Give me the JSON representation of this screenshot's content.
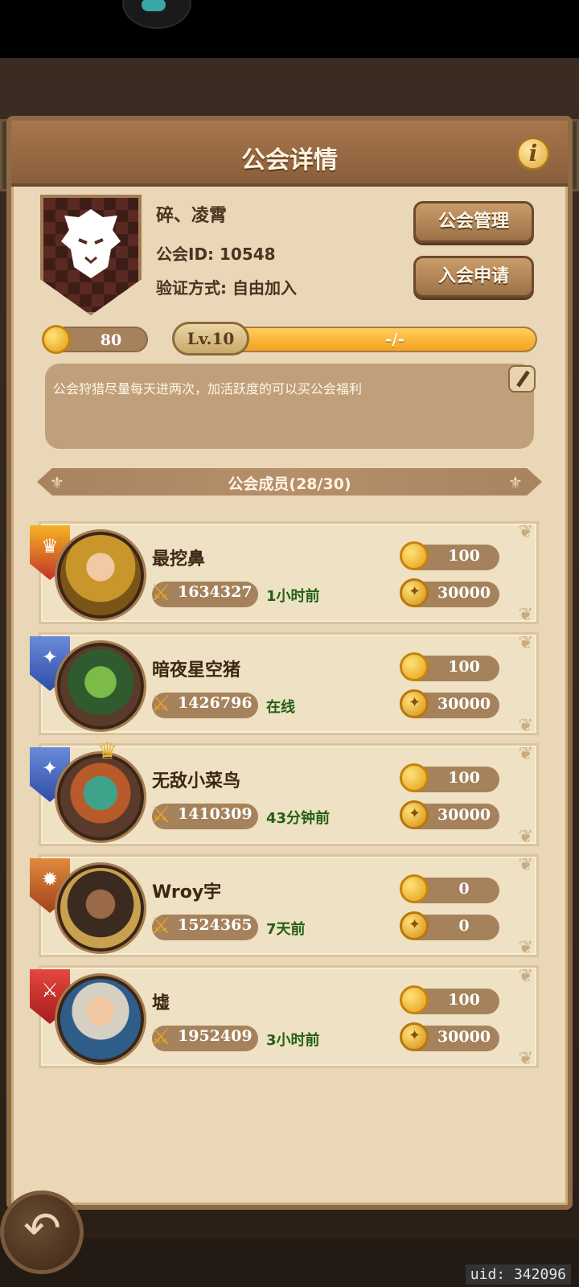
{
  "header": {
    "title": "公会详情",
    "info_icon": "info-icon"
  },
  "guild": {
    "name": "碎、凌霄",
    "id_label": "公会ID: 10548",
    "verify_label": "验证方式: 自由加入",
    "coins": "80",
    "level": "Lv.10",
    "exp_text": "-/-",
    "exp_progress": 1.0,
    "notice": "公会狩猎尽量每天进两次，加活跃度的可以买公会福利"
  },
  "buttons": {
    "manage": "公会管理",
    "apply": "入会申请"
  },
  "members": {
    "title": "公会成员(28/30)",
    "items": [
      {
        "name": "最挖鼻",
        "power": "1634327",
        "last_seen": "1小时前",
        "coin": "100",
        "contribution": "30000",
        "rank": "leader"
      },
      {
        "name": "暗夜星空猪",
        "power": "1426796",
        "last_seen": "在线",
        "coin": "100",
        "contribution": "30000",
        "rank": "officer"
      },
      {
        "name": "无敌小菜鸟",
        "power": "1410309",
        "last_seen": "43分钟前",
        "coin": "100",
        "contribution": "30000",
        "rank": "officer"
      },
      {
        "name": "Wroy宇",
        "power": "1524365",
        "last_seen": "7天前",
        "coin": "0",
        "contribution": "0",
        "rank": "elite"
      },
      {
        "name": "墟",
        "power": "1952409",
        "last_seen": "3小时前",
        "coin": "100",
        "contribution": "30000",
        "rank": "member"
      }
    ]
  },
  "footer": {
    "uid": "uid: 342096"
  },
  "colors": {
    "panel": "#e9d7b7",
    "header": "#8a5e3b",
    "accent_gold": "#f3a21e",
    "online_green": "#2a5b1a"
  }
}
